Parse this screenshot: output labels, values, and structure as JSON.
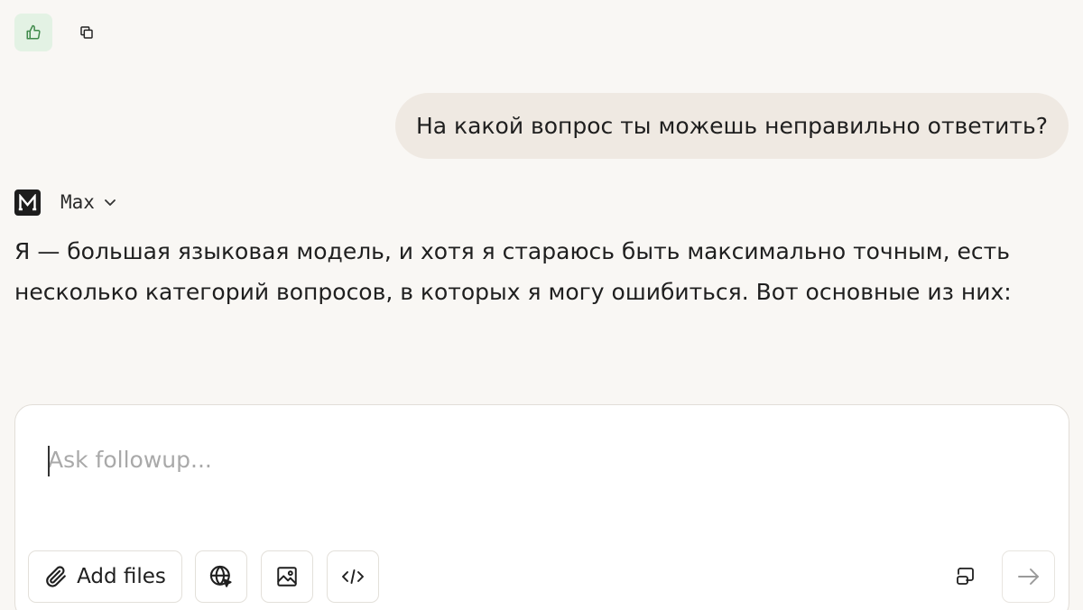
{
  "feedback": {
    "like_icon": "thumbs-up-icon",
    "copy_icon": "copy-icon",
    "like_active_color": "#e3f2e4",
    "like_icon_color": "#3f8a4a"
  },
  "user_message": {
    "text": "На какой вопрос ты можешь неправильно ответить?"
  },
  "assistant": {
    "logo_icon": "m-logo-icon",
    "model_name": "Max",
    "model_dropdown_icon": "chevron-down-icon",
    "response_text": "Я — большая языковая модель, и хотя я стараюсь быть максимально точным, есть несколько категорий вопросов, в которых я могу ошибиться. Вот основные из них:"
  },
  "composer": {
    "placeholder": "Ask followup...",
    "value": "",
    "add_files_label": "Add files",
    "add_files_icon": "paperclip-icon",
    "web_icon": "globe-icon",
    "image_icon": "image-icon",
    "code_icon": "code-icon",
    "mode_icon": "chat-mode-icon",
    "send_icon": "arrow-right-icon"
  }
}
